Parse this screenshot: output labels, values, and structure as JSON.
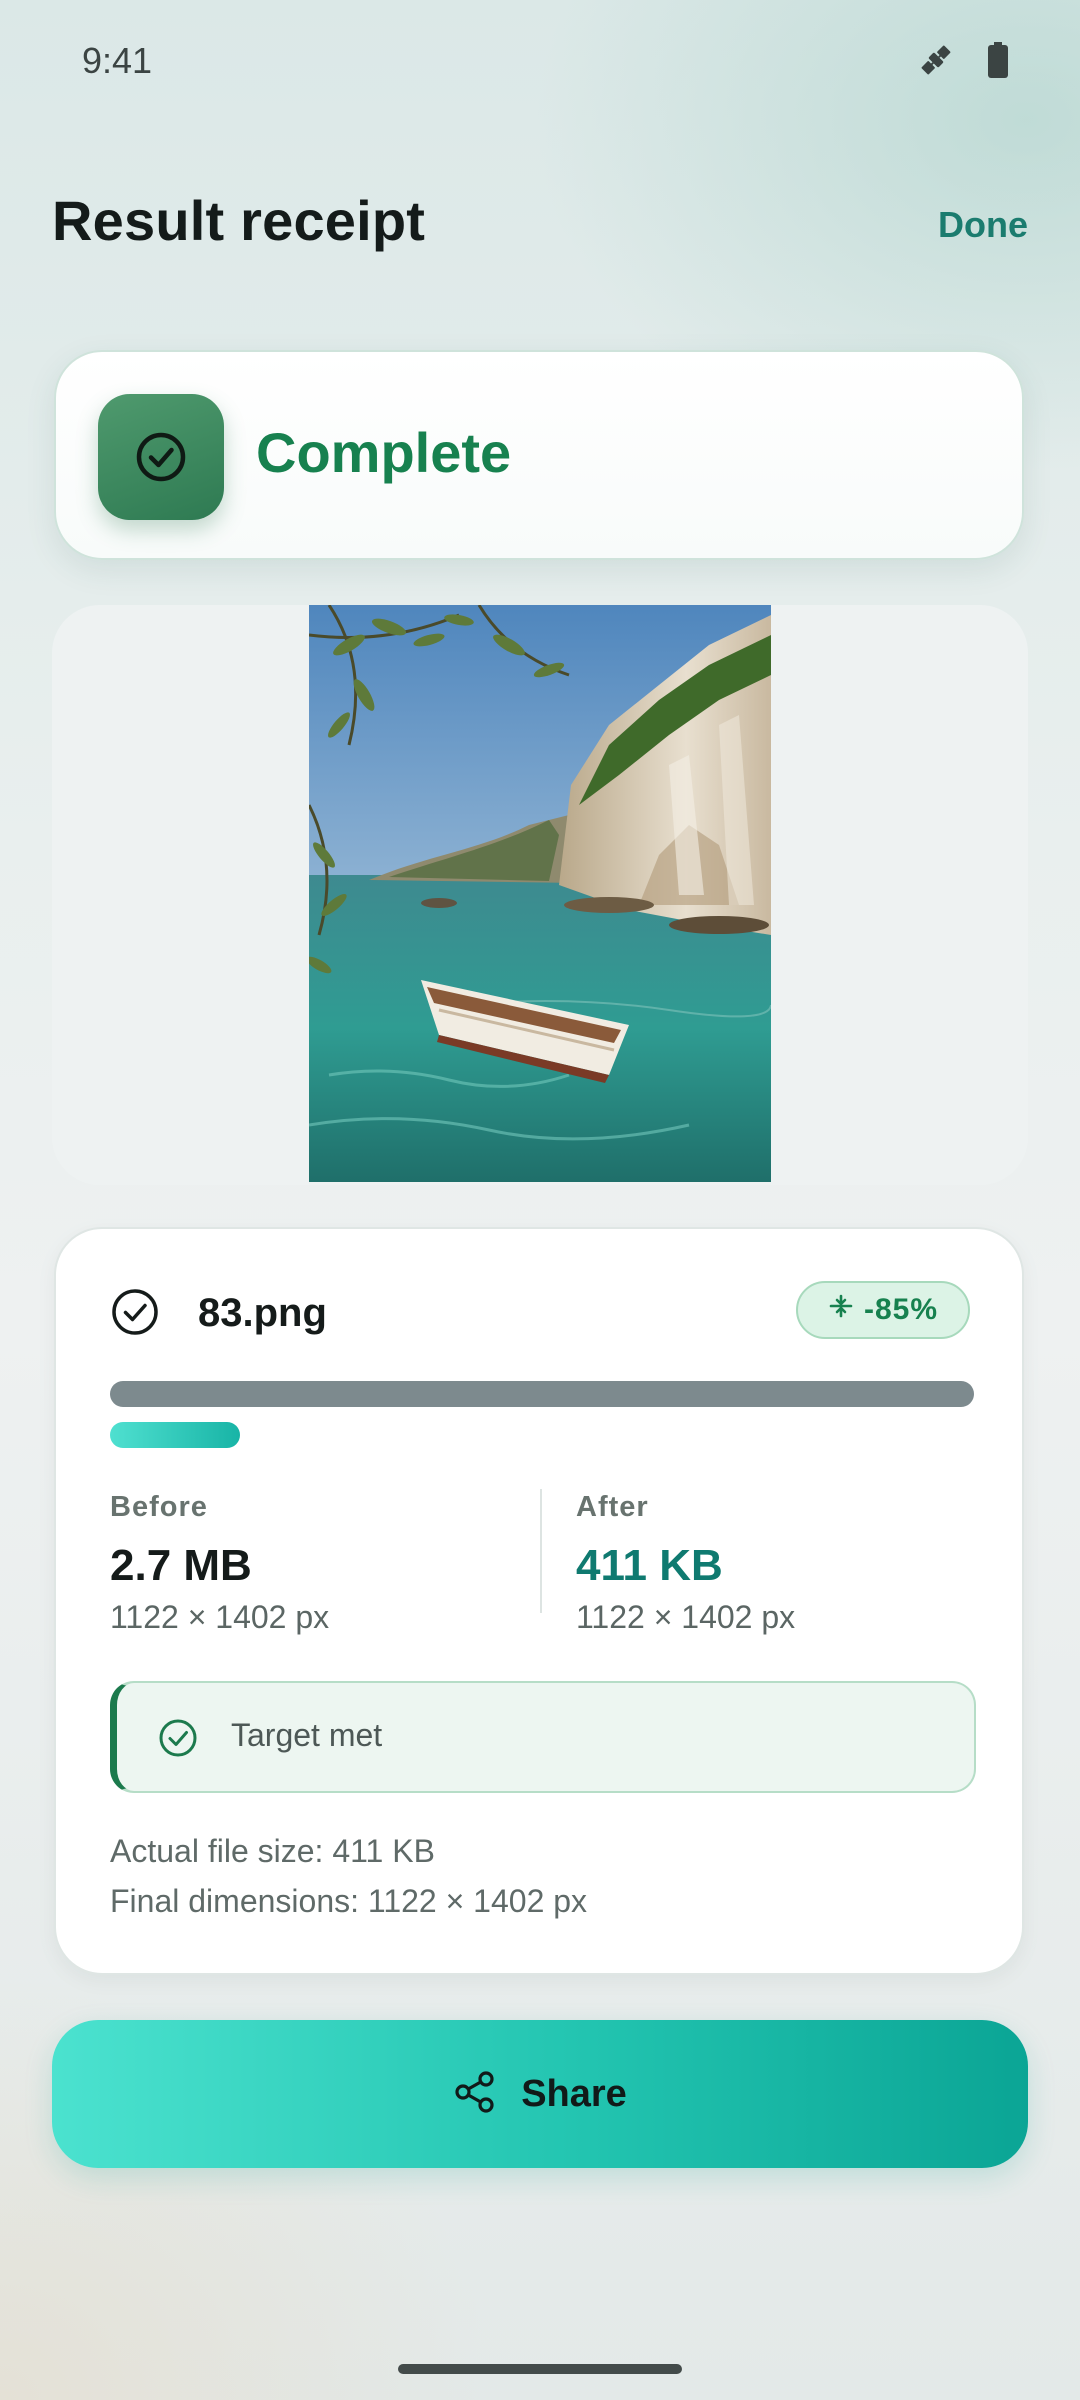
{
  "status_bar": {
    "time": "9:41",
    "icons": [
      "satellite-icon",
      "battery-icon"
    ]
  },
  "header": {
    "title": "Result receipt",
    "done_label": "Done"
  },
  "status_card": {
    "label": "Complete",
    "icon": "check-circle-icon"
  },
  "preview": {
    "description_icon": "image-preview"
  },
  "details": {
    "file_name": "83.png",
    "reduction_badge": "-85%",
    "progress_fraction": 0.15,
    "before": {
      "label": "Before",
      "size": "2.7 MB",
      "dimensions": "1122 × 1402 px"
    },
    "after": {
      "label": "After",
      "size": "411 KB",
      "dimensions": "1122 × 1402 px"
    },
    "target_status": "Target met",
    "actual_file_size": "Actual file size: 411 KB",
    "final_dimensions": "Final dimensions: 1122 × 1402 px"
  },
  "share_button": {
    "label": "Share",
    "icon": "share-icon"
  },
  "colors": {
    "accent": "#1b7c6f",
    "success": "#17814f",
    "after_size": "#0f7a70",
    "share_gradient_start": "#4be2cf",
    "share_gradient_end": "#0ba595"
  }
}
